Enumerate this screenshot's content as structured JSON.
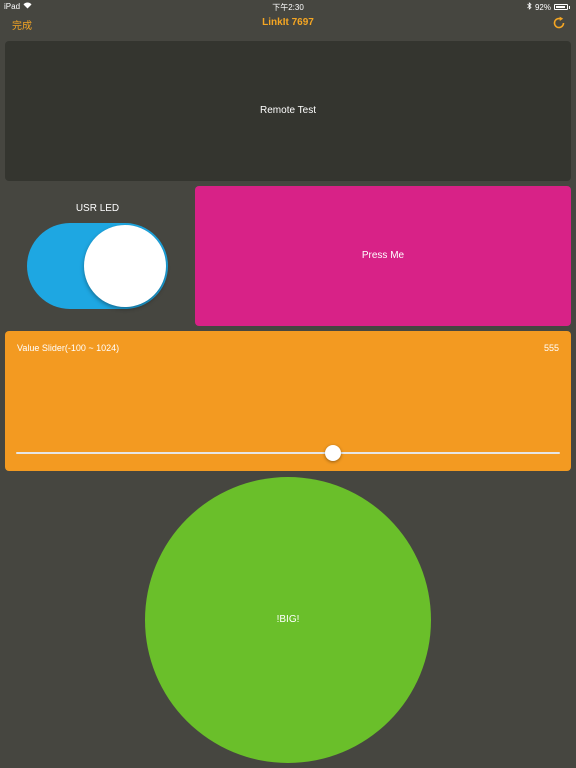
{
  "status_bar": {
    "device": "iPad",
    "time": "下午2:30",
    "battery_text": "92%",
    "battery_level": 0.92
  },
  "nav": {
    "done_label": "完成",
    "title": "LinkIt 7697",
    "refresh_icon": "refresh-icon"
  },
  "remote_panel": {
    "label": "Remote Test"
  },
  "usr_led": {
    "label": "USR LED",
    "state": "on",
    "color": "#1ea7e2"
  },
  "press_button": {
    "label": "Press Me",
    "color": "#d82287"
  },
  "value_slider": {
    "label": "Value Slider(-100 ~ 1024)",
    "value": "555",
    "min": -100,
    "max": 1024,
    "current": 555,
    "color": "#f39a21"
  },
  "big_button": {
    "label": "!BIG!",
    "color": "#6abf2a"
  },
  "colors": {
    "background": "#464640",
    "accent": "#f5a623",
    "panel": "#34352f"
  }
}
